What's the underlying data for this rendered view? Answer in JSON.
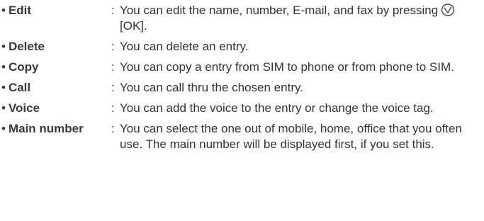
{
  "bullet": "•",
  "colon": ":",
  "items": [
    {
      "term": "Edit",
      "desc_before": "You can edit the name, number, E-mail, and fax by pressing",
      "icon": "ok-key-icon",
      "desc_after": "[OK]."
    },
    {
      "term": "Delete",
      "desc": "You can delete an entry."
    },
    {
      "term": "Copy",
      "desc": "You can copy a entry from SIM to phone or from phone to SIM."
    },
    {
      "term": "Call",
      "desc": "You can call thru the chosen entry."
    },
    {
      "term": "Voice",
      "desc": "You can add the voice to the entry or change the voice tag."
    },
    {
      "term": "Main number",
      "desc": "You can select the one out of mobile, home, office that you often use. The main number will be displayed first, if you set this."
    }
  ]
}
